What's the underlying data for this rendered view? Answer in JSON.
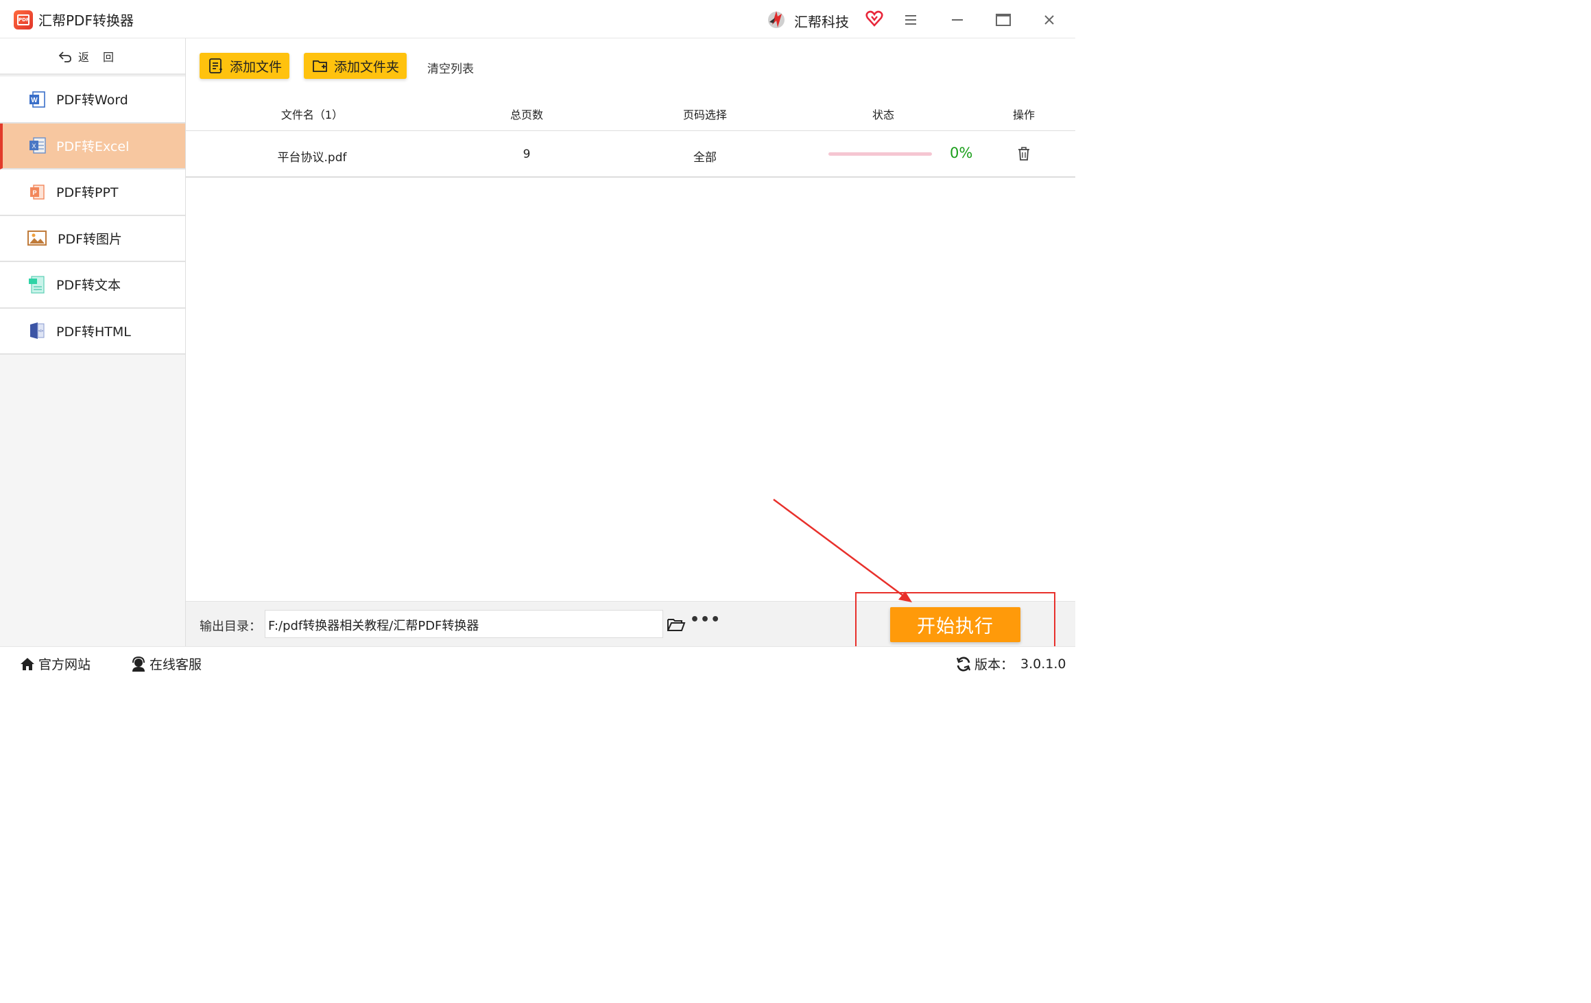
{
  "window": {
    "title": "汇帮PDF转换器",
    "logo_text": "PDF",
    "brand_name": "汇帮科技",
    "accent_color": "#ffc20e",
    "start_color": "#ff9a0a",
    "active_nav_color": "#f7c7a0"
  },
  "sidebar": {
    "back_label": "返回",
    "items": [
      {
        "label": "PDF转Word",
        "icon": "word-icon",
        "active": false
      },
      {
        "label": "PDF转Excel",
        "icon": "excel-icon",
        "active": true
      },
      {
        "label": "PDF转PPT",
        "icon": "ppt-icon",
        "active": false
      },
      {
        "label": "PDF转图片",
        "icon": "image-icon",
        "active": false
      },
      {
        "label": "PDF转文本",
        "icon": "text-icon",
        "active": false
      },
      {
        "label": "PDF转HTML",
        "icon": "html-icon",
        "active": false
      }
    ]
  },
  "toolbar": {
    "add_file": "添加文件",
    "add_folder": "添加文件夹",
    "clear_list": "清空列表"
  },
  "table": {
    "headers": {
      "filename": "文件名（1）",
      "pages": "总页数",
      "page_select": "页码选择",
      "status": "状态",
      "actions": "操作"
    },
    "rows": [
      {
        "filename": "平台协议.pdf",
        "pages": "9",
        "page_select": "全部",
        "progress": 0,
        "progress_text": "0%"
      }
    ]
  },
  "output": {
    "label": "输出目录：",
    "path": "F:/pdf转换器相关教程/汇帮PDF转换器",
    "more": "•••",
    "start_label": "开始执行"
  },
  "statusbar": {
    "site": "官方网站",
    "service": "在线客服",
    "version_label": "版本：",
    "version": "3.0.1.0"
  }
}
